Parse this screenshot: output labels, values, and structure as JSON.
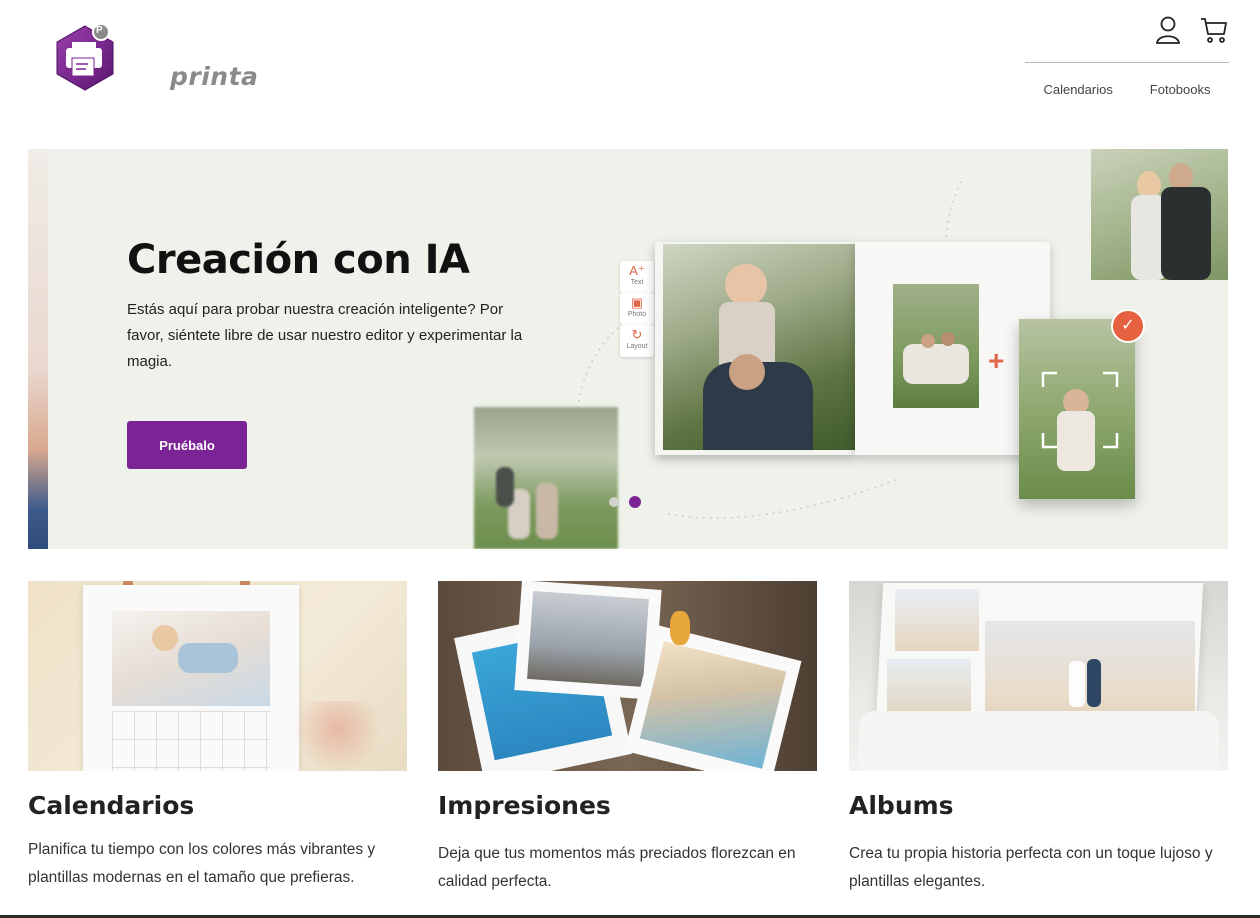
{
  "brand": {
    "name": "printa",
    "badge": "P",
    "color": "#7b2496"
  },
  "header": {
    "icons": [
      "user-icon",
      "cart-icon"
    ],
    "nav": [
      {
        "label": "Calendarios"
      },
      {
        "label": "Fotobooks"
      }
    ]
  },
  "hero": {
    "title": "Creación con IA",
    "description": "Estás aquí para probar nuestra creación inteligente? Por favor, siéntete libre de usar nuestro editor y experimentar la magia.",
    "button_label": "Pruébalo",
    "background": "#eef2ea",
    "tools": [
      {
        "label": "Text",
        "icon": "text-add-icon"
      },
      {
        "label": "Photo",
        "icon": "photo-add-icon"
      },
      {
        "label": "Layout",
        "icon": "layout-refresh-icon"
      }
    ],
    "slides": {
      "count": 2,
      "active": 2
    }
  },
  "cards": [
    {
      "title": "Calendarios",
      "description": "Planifica tu tiempo con los colores más vibrantes y plantillas modernas en el tamaño que prefieras."
    },
    {
      "title": "Impresiones",
      "description": "Deja que tus momentos más preciados florezcan en calidad perfecta."
    },
    {
      "title": "Albums",
      "description": "Crea tu propia historia perfecta con un toque lujoso y plantillas elegantes."
    }
  ]
}
